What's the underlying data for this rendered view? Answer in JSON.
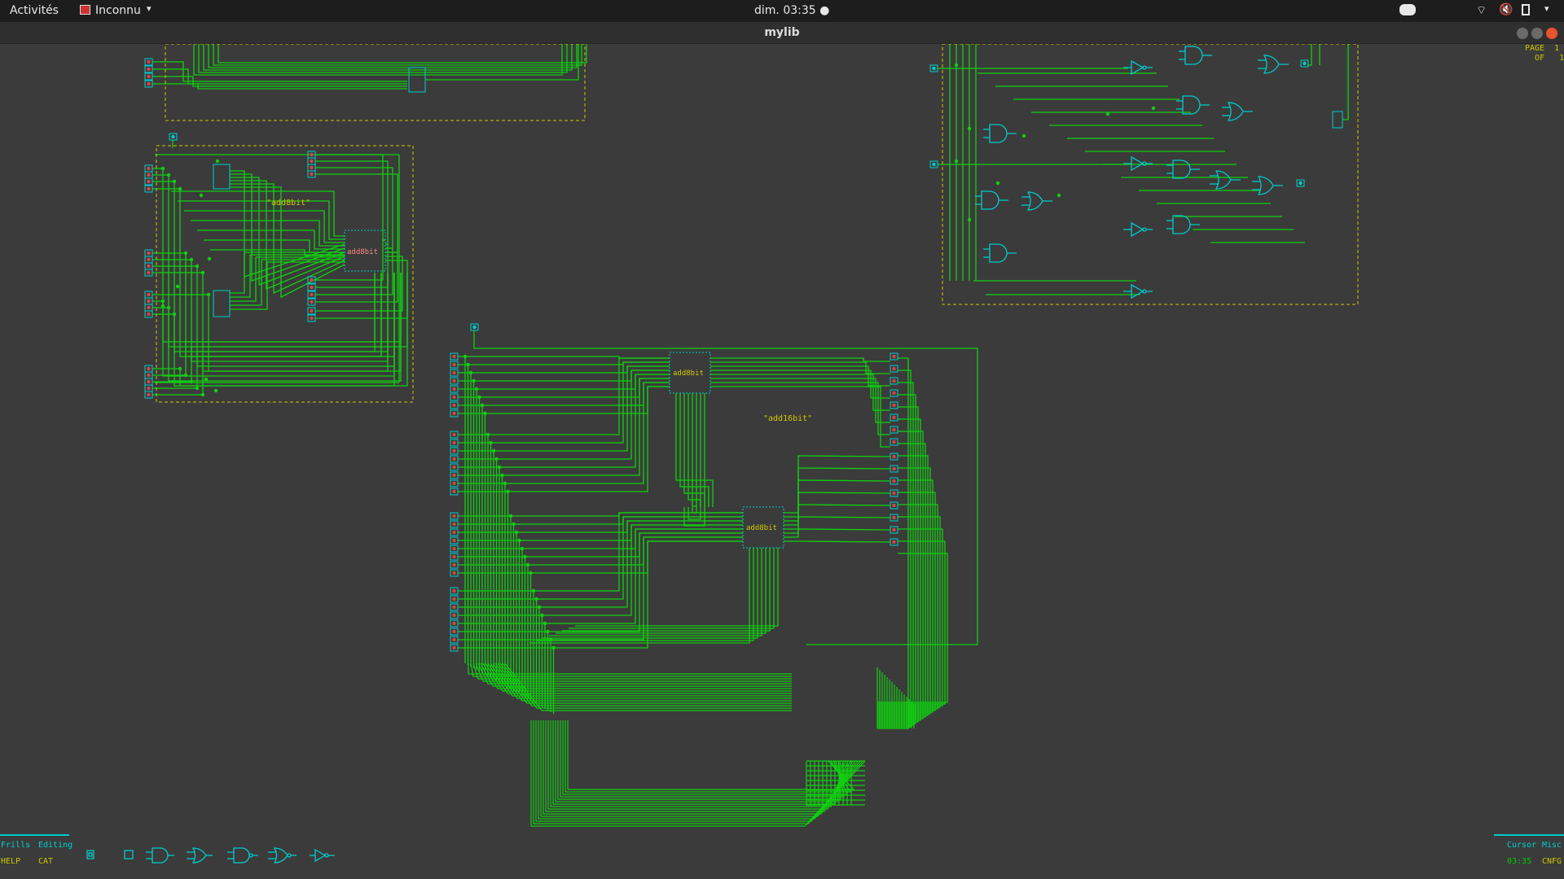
{
  "topbar": {
    "activities": "Activités",
    "app_menu": "Inconnu",
    "clock": "dim. 03:35 ●"
  },
  "window": {
    "title": "mylib"
  },
  "page_indicator": {
    "page_label": "PAGE",
    "page_num": "1",
    "of_label": "OF",
    "of_num": "1"
  },
  "schematic": {
    "module1_label": "\"add8bit\"",
    "module1_block": "add8bit",
    "module2_label": "\"add16bit\"",
    "module2_block_a": "add8bit",
    "module2_block_b": "add8bit"
  },
  "statusbar": {
    "frills": "Frills",
    "editing": "Editing",
    "help": "HELP",
    "cat": "CAT",
    "cursor": "Cursor",
    "misc": "Misc",
    "time": "03:35",
    "cnfg": "CNFG"
  },
  "palette": [
    "and-gate-icon",
    "or-gate-icon",
    "nand-gate-icon",
    "nor-gate-icon",
    "not-gate-icon"
  ],
  "colors": {
    "wire": "#10d010",
    "pin": "#00cccc",
    "label": "#d4c800",
    "background": "#3b3b3b"
  }
}
